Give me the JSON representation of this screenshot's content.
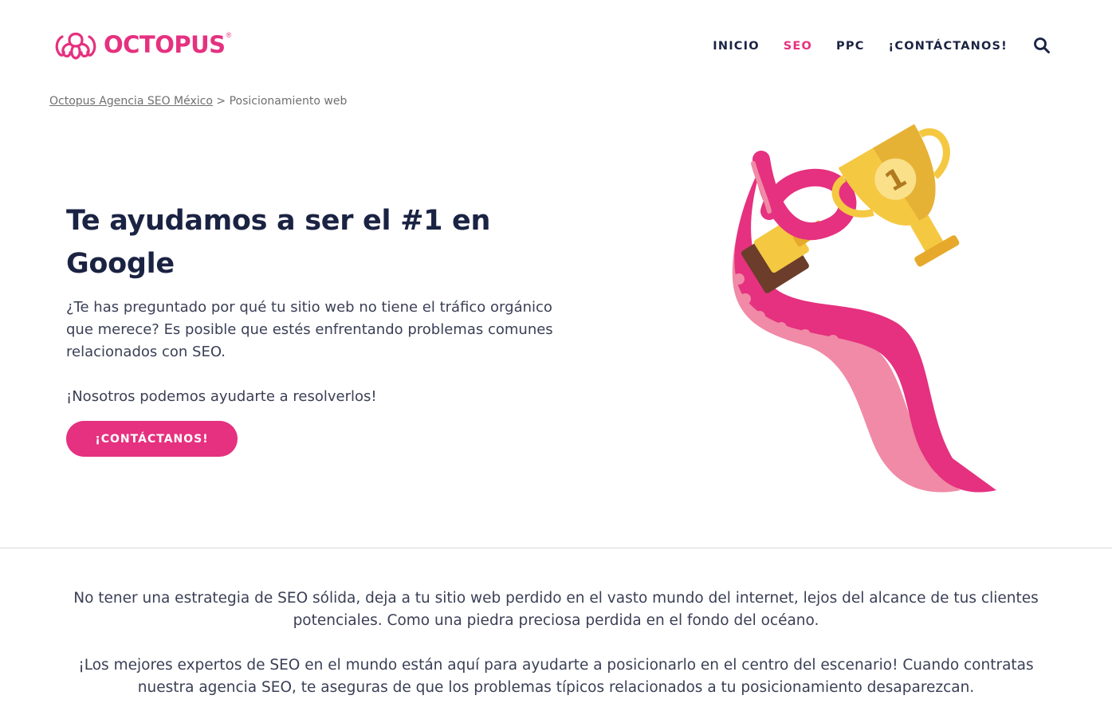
{
  "brand": {
    "name": "OCTOPUS",
    "registered": "®",
    "color": "#e5317f",
    "logo_icon": "octopus-icon"
  },
  "nav": {
    "items": [
      {
        "label": "INICIO",
        "active": false
      },
      {
        "label": "SEO",
        "active": true
      },
      {
        "label": "PPC",
        "active": false
      },
      {
        "label": "¡CONTÁCTANOS!",
        "active": false
      }
    ],
    "search_icon": "search-icon"
  },
  "breadcrumb": {
    "home": "Octopus Agencia SEO México",
    "separator": ">",
    "current": "Posicionamiento web"
  },
  "hero": {
    "title": "Te ayudamos a ser el #1 en Google",
    "paragraph": "¿Te has preguntado por qué tu sitio web no tiene el tráfico orgánico que merece? Es posible que estés enfrentando problemas comunes relacionados con SEO.",
    "paragraph2": "¡Nosotros podemos ayudarte a resolverlos!",
    "cta_label": "¡CONTÁCTANOS!",
    "illustration": "octopus-tentacle-holding-trophy-illustration",
    "trophy_label": "1"
  },
  "intro": {
    "p1": "No tener una estrategia de SEO sólida, deja a tu sitio web perdido en el vasto mundo del internet, lejos del alcance de tus clientes potenciales. Como una piedra preciosa perdida en el fondo del océano.",
    "p2": "¡Los mejores expertos de SEO en el mundo están aquí para ayudarte a posicionarlo en el centro del escenario! Cuando contratas nuestra agencia SEO, te aseguras de que los problemas típicos relacionados a tu posicionamiento desaparezcan."
  },
  "colors": {
    "accent": "#e5317f",
    "navy": "#1b2343",
    "tentacle_light": "#f08aa6",
    "trophy_gold": "#f5c842"
  }
}
